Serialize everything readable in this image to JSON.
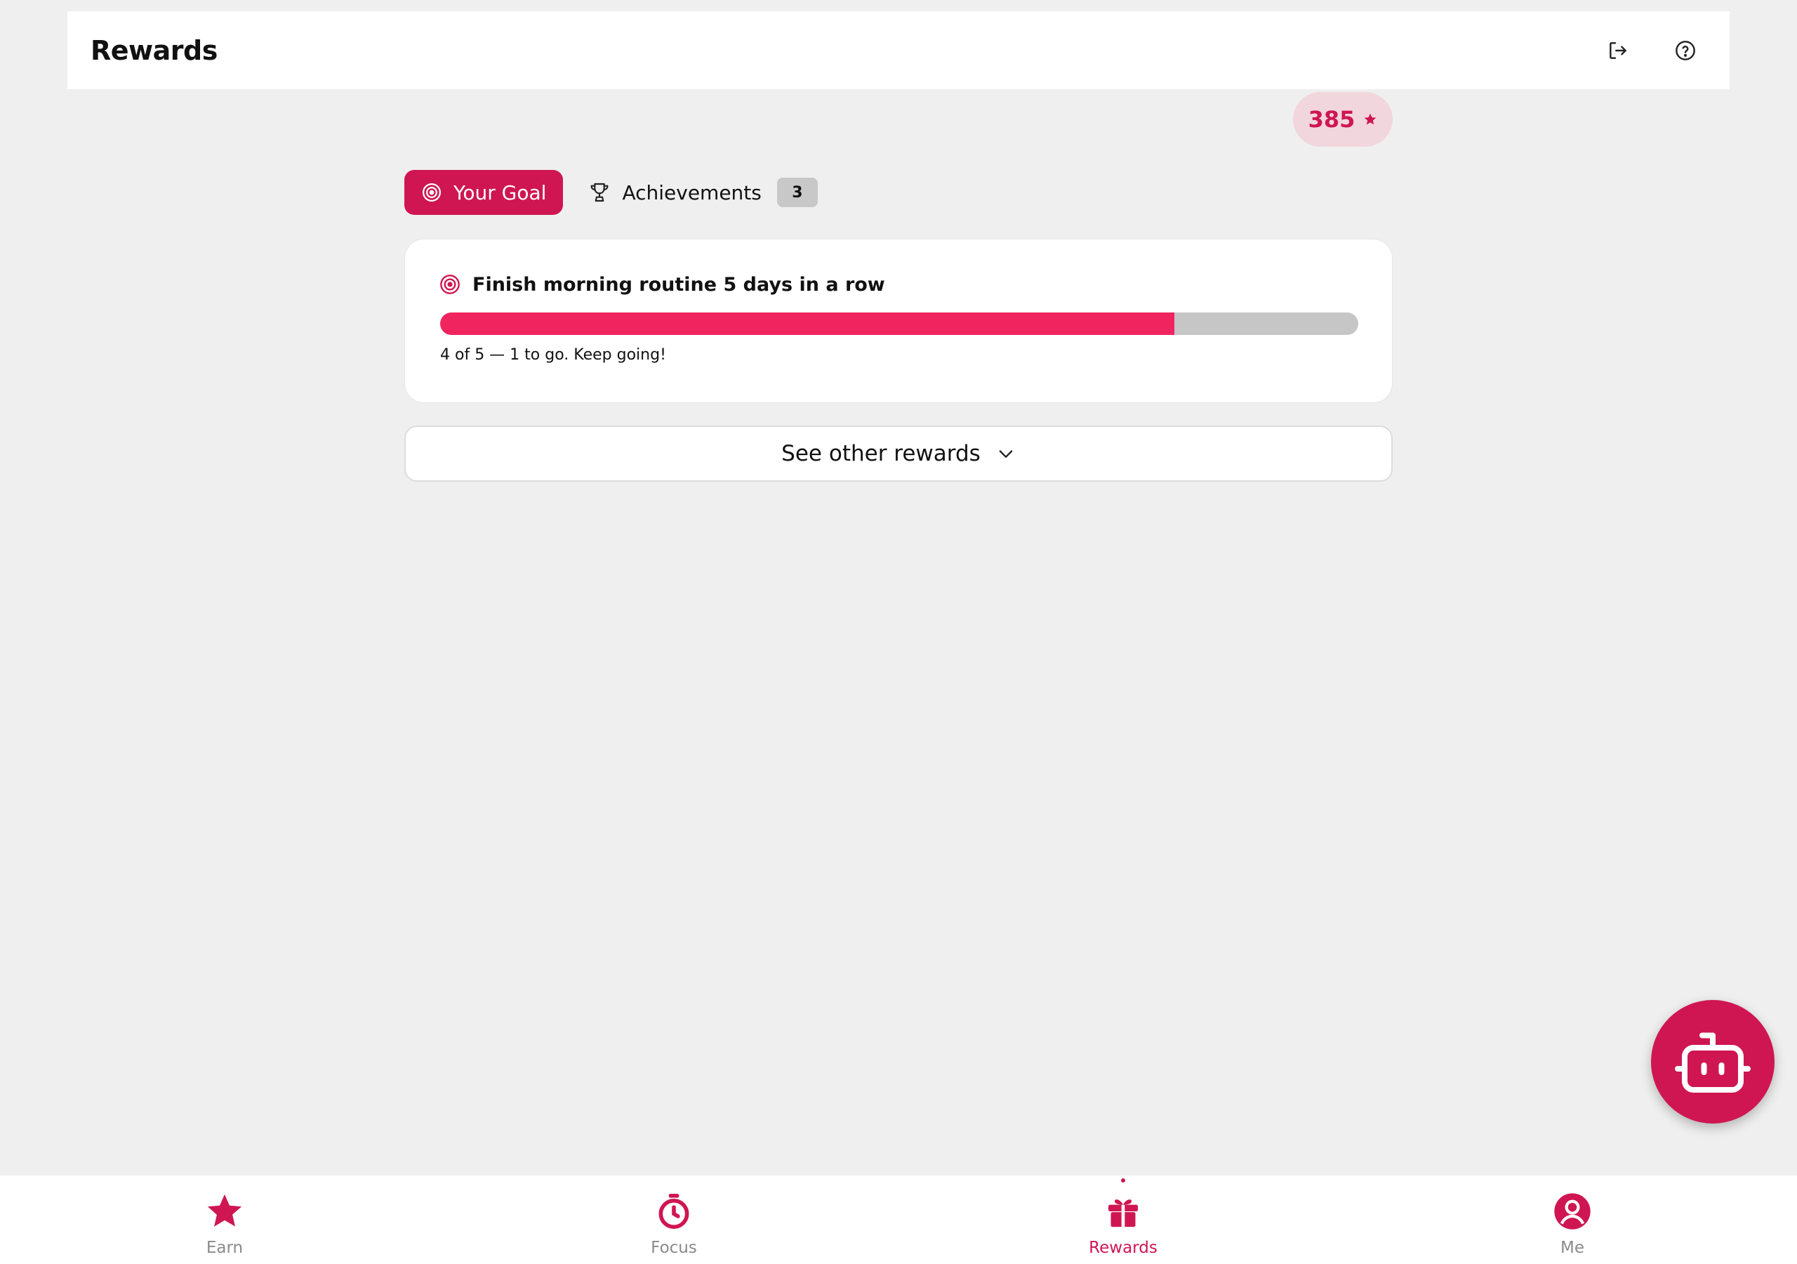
{
  "header": {
    "title": "Rewards",
    "icons": [
      "logout-icon",
      "help-icon"
    ]
  },
  "points": {
    "value": "385",
    "icon": "star-icon"
  },
  "tabs": {
    "goal_label": "Your Goal",
    "achievements_label": "Achievements",
    "achievements_count": "3"
  },
  "goal": {
    "title": "Finish morning routine 5 days in a row",
    "progress_current": 4,
    "progress_total": 5,
    "progress_text": "4 of 5 — 1 to go. Keep going!"
  },
  "see_other": {
    "label": "See other rewards"
  },
  "nav": {
    "items": [
      {
        "label": "Earn",
        "icon": "star-icon"
      },
      {
        "label": "Focus",
        "icon": "timer-icon"
      },
      {
        "label": "Rewards",
        "icon": "gift-icon",
        "active": true
      },
      {
        "label": "Me",
        "icon": "user-icon"
      }
    ]
  },
  "colors": {
    "accent": "#cf1652",
    "progress": "#f0245f",
    "background": "#efefef"
  }
}
